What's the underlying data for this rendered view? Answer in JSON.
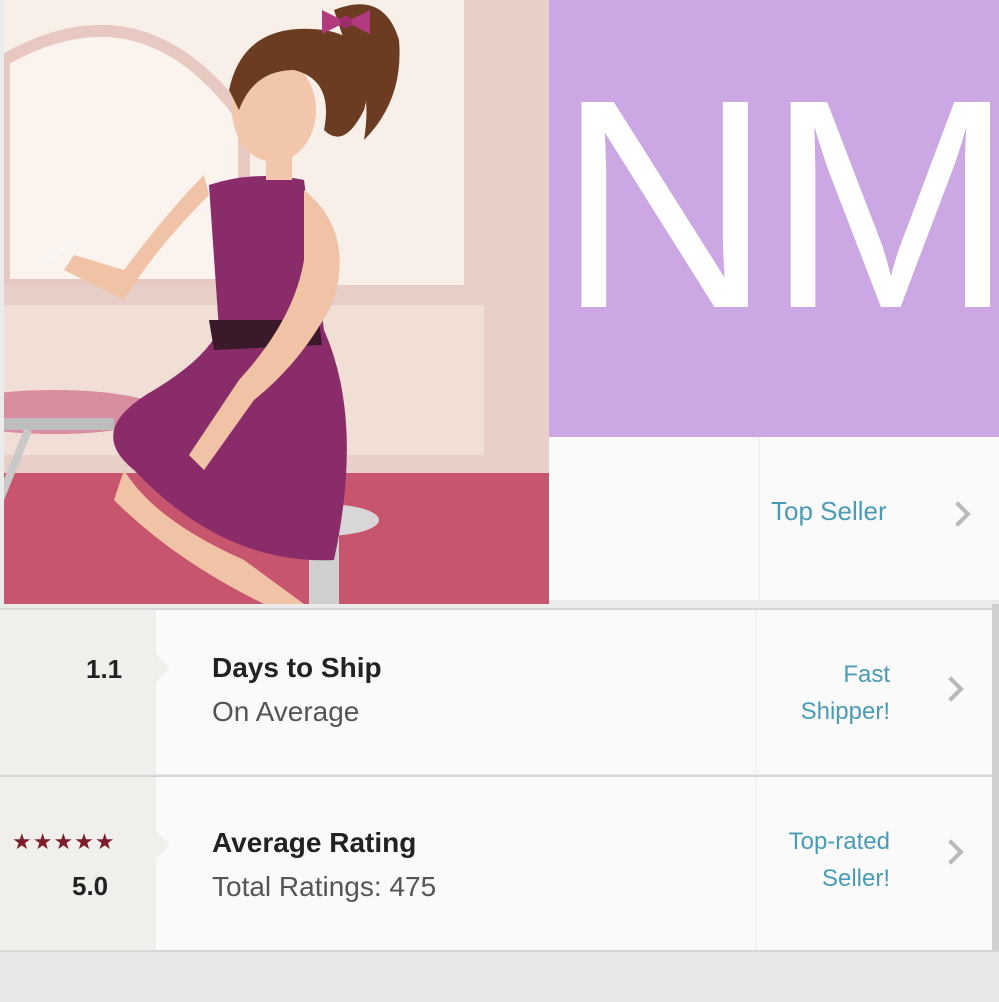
{
  "shop": {
    "initials": "NM",
    "avatar_description_icon": "pinup-diner-girl-illustration",
    "background_color": "#cba7e3",
    "top_badge": "Top Seller"
  },
  "stats": [
    {
      "value": "1.1",
      "title": "Days to Ship",
      "subtitle": "On Average",
      "badge_line1": "Fast",
      "badge_line2": "Shipper!"
    },
    {
      "stars": "★★★★★",
      "value": "5.0",
      "title": "Average Rating",
      "subtitle": "Total Ratings: 475",
      "badge_line1": "Top-rated",
      "badge_line2": "Seller!"
    }
  ],
  "colors": {
    "link": "#4a9bb5",
    "star": "#7b1e2a"
  }
}
